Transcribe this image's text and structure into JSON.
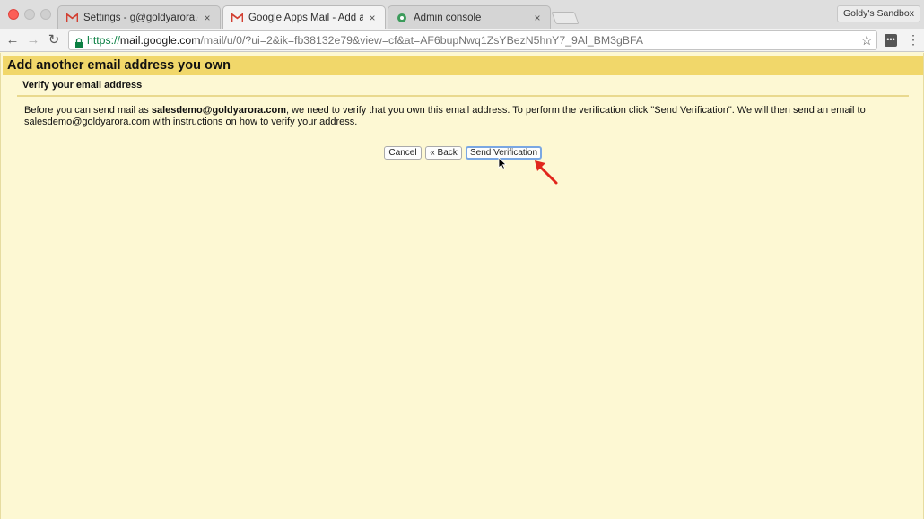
{
  "browser": {
    "tabs": [
      {
        "label": "Settings - g@goldyarora.com",
        "icon": "gmail-icon",
        "active": false
      },
      {
        "label": "Google Apps Mail - Add anoth",
        "icon": "gmail-icon",
        "active": true
      },
      {
        "label": "Admin console",
        "icon": "admin-console-icon",
        "active": false
      }
    ],
    "profile_name": "Goldy's Sandbox",
    "url": {
      "scheme": "https://",
      "host": "mail.google.com",
      "path": "/mail/u/0/?ui=2&ik=fb38132e79&view=cf&at=AF6bupNwq1ZsYBezN5hnY7_9Al_BM3gBFA"
    },
    "colors": {
      "secure": "#0b8043",
      "accent_red": "#e1261c"
    }
  },
  "page": {
    "title": "Add another email address you own",
    "subtitle": "Verify your email address",
    "body_prefix": "Before you can send mail as ",
    "body_email": "salesdemo@goldyarora.com",
    "body_suffix": ", we need to verify that you own this email address. To perform the verification click \"Send Verification\". We will then send an email to salesdemo@goldyarora.com with instructions on how to verify your address.",
    "buttons": {
      "cancel": "Cancel",
      "back": "« Back",
      "send": "Send Verification"
    },
    "colors": {
      "header_bg": "#f1d76a",
      "page_bg": "#fdf8d3"
    }
  }
}
